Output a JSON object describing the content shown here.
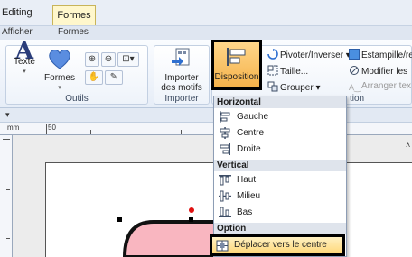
{
  "tabs": {
    "editing": "Editing",
    "formes": "Formes",
    "afficher": "Afficher",
    "formes_sub": "Formes"
  },
  "ribbon": {
    "outils_group": {
      "label": "Outils",
      "texte": "Texte",
      "formes": "Formes"
    },
    "importer_group": {
      "label": "Importer",
      "importer_btn_line1": "Importer",
      "importer_btn_line2": "des motifs"
    },
    "disposition_btn": "Disposition",
    "side_items": {
      "pivoter": "Pivoter/Inverser",
      "estampille": "Estampille/re",
      "taille": "Taille...",
      "modifier": "Modifier les",
      "grouper": "Grouper",
      "arranger": "Arranger tex"
    },
    "tion_label": "tion"
  },
  "ruler": {
    "mm_label": "mm",
    "mark_50": "50"
  },
  "dropdown": {
    "horizontal_header": "Horizontal",
    "gauche": "Gauche",
    "centre": "Centre",
    "droite": "Droite",
    "vertical_header": "Vertical",
    "haut": "Haut",
    "milieu": "Milieu",
    "bas": "Bas",
    "option_header": "Option",
    "deplacer": "Déplacer vers le centre"
  },
  "colors": {
    "accent_orange": "#f5b24a",
    "shape_fill": "#f9b6c0",
    "handle_red": "#e01010"
  }
}
